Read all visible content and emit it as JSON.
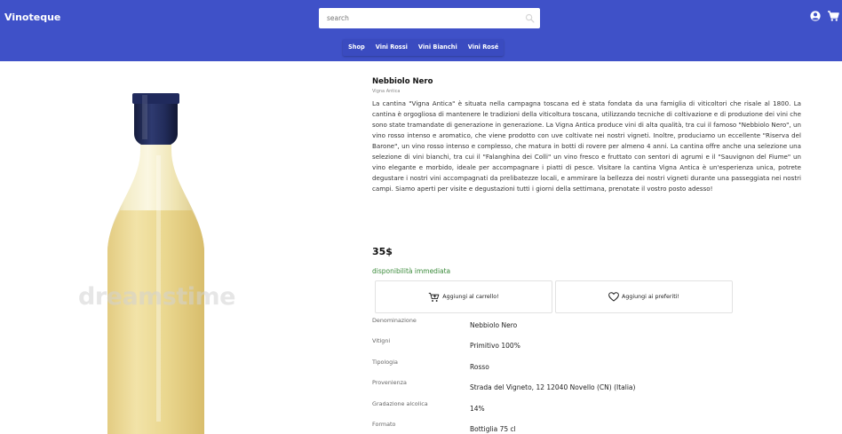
{
  "header": {
    "brand": "Vinoteque",
    "search_placeholder": "search",
    "icons": [
      "search-icon",
      "user-icon",
      "cart-icon"
    ],
    "nav": [
      "Shop",
      "Vini Rossi",
      "Vini Bianchi",
      "Vini Rosé"
    ],
    "bar_color": "#3f51c8"
  },
  "product": {
    "name": "Nebbiolo Nero",
    "winery": "Vigna Antica",
    "description": "La cantina \"Vigna Antica\" è situata nella campagna toscana ed è stata fondata da una famiglia di viticoltori che risale al 1800. La cantina è orgogliosa di mantenere le tradizioni della viticoltura toscana, utilizzando tecniche di coltivazione e di produzione dei vini che sono state tramandate di generazione in generazione. La Vigna Antica produce vini di alta qualità, tra cui il famoso \"Nebbiolo Nero\", un vino rosso intenso e aromatico, che viene prodotto con uve coltivate nei nostri vigneti. Inoltre, produciamo un eccellente \"Riserva del Barone\", un vino rosso intenso e complesso, che matura in botti di rovere per almeno 4 anni. La cantina offre anche una selezione una selezione di vini bianchi, tra cui il \"Falanghina dei Colli\" un vino fresco e fruttato con sentori di agrumi e il \"Sauvignon del Fiume\" un vino elegante e morbido, ideale per accompagnare i piatti di pesce. Visitare la cantina Vigna Antica è un'esperienza unica, potrete degustare i nostri vini accompagnati da prelibatezze locali, e ammirare la bellezza dei nostri vigneti durante una passeggiata nei nostri campi. Siamo aperti per visite e degustazioni tutti i giorni della settimana, prenotate il vostro posto adesso!",
    "price": "35$",
    "availability": "disponibilità immediata",
    "availability_color": "#3a8a3a",
    "image_watermark": "dreamstime"
  },
  "actions": {
    "add_to_cart": "Aggiungi al carrello!",
    "add_to_favorites": "Aggiungi ai preferiti!"
  },
  "specs": [
    {
      "label": "Denominazione",
      "value": "Nebbiolo Nero"
    },
    {
      "label": "Vitigni",
      "value": "Primitivo 100%"
    },
    {
      "label": "Tipologia",
      "value": "Rosso"
    },
    {
      "label": "Provenienza",
      "value": "Strada del Vigneto, 12 12040 Novello (CN) (Italia)"
    },
    {
      "label": "Gradazione alcolica",
      "value": "14%"
    },
    {
      "label": "Formato",
      "value": "Bottiglia 75 cl"
    }
  ]
}
